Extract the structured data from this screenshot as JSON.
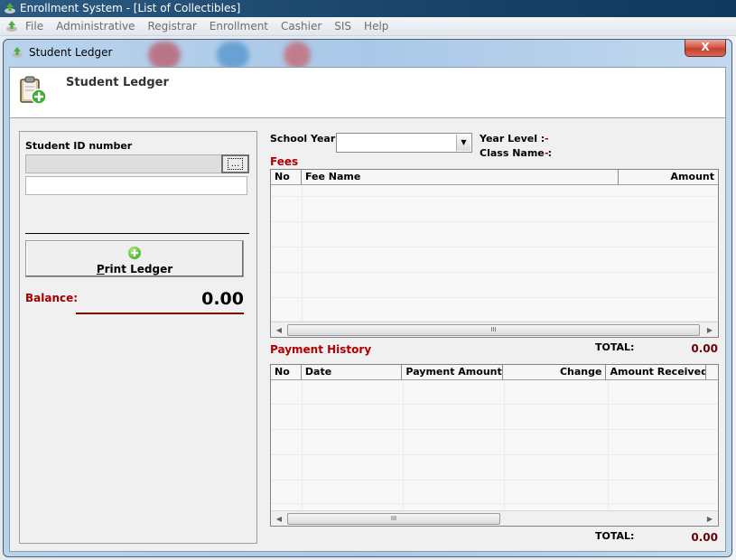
{
  "app": {
    "title": "Enrollment System - [List of Collectibles]"
  },
  "menubar": {
    "items": [
      "File",
      "Administrative",
      "Registrar",
      "Enrollment",
      "Cashier",
      "SIS",
      "Help"
    ]
  },
  "window": {
    "title": "Student Ledger",
    "close_label": "X",
    "header_title": "Student Ledger"
  },
  "student": {
    "id_label": "Student ID number",
    "id_value": "",
    "browse_label": "...",
    "name_value": ""
  },
  "print_button": {
    "label": "Print Ledger",
    "icon": "plus-circle-icon"
  },
  "balance": {
    "label": "Balance:",
    "value": "0.00"
  },
  "filters": {
    "school_year_label": "School Year",
    "school_year_value": "",
    "year_level_label": "Year Level :",
    "year_level_value": "-",
    "class_name_label": "Class Name :",
    "class_name_value": "-"
  },
  "fees": {
    "title": "Fees",
    "columns": [
      "No",
      "Fee Name",
      "Amount"
    ],
    "rows": [],
    "scroll_marker": "III",
    "total_label": "TOTAL:",
    "total_value": "0.00"
  },
  "payment_history": {
    "title": "Payment History",
    "columns": [
      "No",
      "Date",
      "Payment Amount",
      "Change",
      "Amount Received",
      ""
    ],
    "rows": [],
    "scroll_marker": "III",
    "total_label": "TOTAL:",
    "total_value": "0.00"
  },
  "colors": {
    "accent_red": "#b00000",
    "balance_line": "#7a0000"
  }
}
